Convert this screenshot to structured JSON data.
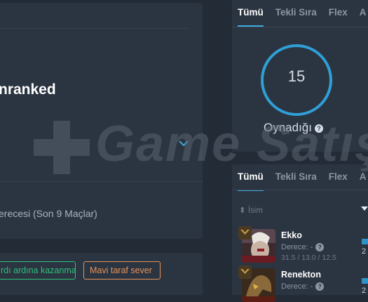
{
  "left_panel": {
    "rank_title": "nranked",
    "winrate_text": "erecesi (Son 9 Maçlar)"
  },
  "tags": [
    {
      "label": "rdı ardına kazanma",
      "color": "#2ec07a"
    },
    {
      "label": "Mavi taraf sever",
      "color": "#e5935a"
    }
  ],
  "top_tabs": [
    "Tümü",
    "Tekli Sıra",
    "Flex",
    "A"
  ],
  "stats": {
    "games_played": "15",
    "played_label": "Oynadığı",
    "help_icon": "question-icon"
  },
  "bottom_tabs": [
    "Tümü",
    "Tekli Sıra",
    "Flex",
    "A"
  ],
  "champion_table": {
    "name_header": "İsim",
    "rows": [
      {
        "name": "Ekko",
        "rank": "Derece: -",
        "kda": "31.5 / 13.0 / 12.5",
        "games": "2",
        "icon": "ekko-portrait"
      },
      {
        "name": "Renekton",
        "rank": "Derece: -",
        "kda": "",
        "games": "2",
        "icon": "renekton-portrait"
      }
    ]
  },
  "watermark": {
    "text": "Game Satış"
  },
  "colors": {
    "accent": "#3fa8d8",
    "background": "#232b36",
    "panel": "#2b3441"
  }
}
